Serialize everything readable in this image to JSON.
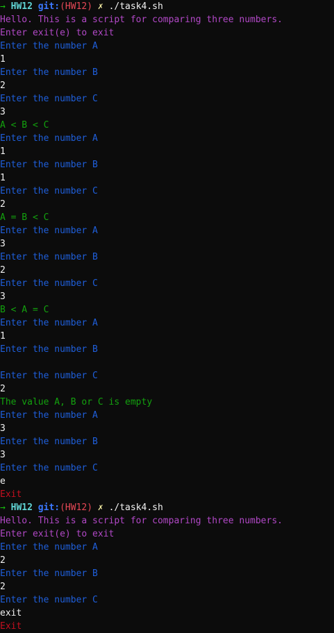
{
  "window": {
    "title": ""
  },
  "colors": {
    "background": "#0c0c0c",
    "purple": "#b148c6",
    "red": "#c50f1f",
    "blue": "#1f5fdb",
    "white": "#f2f2f2",
    "green": "#13a10e",
    "cyan": "#61d6d6",
    "yellow": "#f9f1a5"
  },
  "prompt": {
    "arrow": "→",
    "dir": "HW12",
    "git_label": "git:",
    "branch": "(HW12)",
    "dirty_mark": "✗",
    "command": "./task4.sh"
  },
  "lines": [
    {
      "kind": "prompt"
    },
    {
      "text": "Hello. This is a script for comparing three numbers.",
      "color": "purple"
    },
    {
      "text": "Enter exit(e) to exit",
      "color": "purple"
    },
    {
      "text": "Enter the number A",
      "color": "blue"
    },
    {
      "text": "1",
      "color": "white"
    },
    {
      "text": "Enter the number B",
      "color": "blue"
    },
    {
      "text": "2",
      "color": "white"
    },
    {
      "text": "Enter the number C",
      "color": "blue"
    },
    {
      "text": "3",
      "color": "white"
    },
    {
      "text": "A < B < C",
      "color": "green"
    },
    {
      "text": "Enter the number A",
      "color": "blue"
    },
    {
      "text": "1",
      "color": "white"
    },
    {
      "text": "Enter the number B",
      "color": "blue"
    },
    {
      "text": "1",
      "color": "white"
    },
    {
      "text": "Enter the number C",
      "color": "blue"
    },
    {
      "text": "2",
      "color": "white"
    },
    {
      "text": "A = B < C",
      "color": "green"
    },
    {
      "text": "Enter the number A",
      "color": "blue"
    },
    {
      "text": "3",
      "color": "white"
    },
    {
      "text": "Enter the number B",
      "color": "blue"
    },
    {
      "text": "2",
      "color": "white"
    },
    {
      "text": "Enter the number C",
      "color": "blue"
    },
    {
      "text": "3",
      "color": "white"
    },
    {
      "text": "B < A = C",
      "color": "green"
    },
    {
      "text": "Enter the number A",
      "color": "blue"
    },
    {
      "text": "1",
      "color": "white"
    },
    {
      "text": "Enter the number B",
      "color": "blue"
    },
    {
      "text": "",
      "color": "white"
    },
    {
      "text": "Enter the number C",
      "color": "blue"
    },
    {
      "text": "2",
      "color": "white"
    },
    {
      "text": "The value A, B or C is empty",
      "color": "green"
    },
    {
      "text": "Enter the number A",
      "color": "blue"
    },
    {
      "text": "3",
      "color": "white"
    },
    {
      "text": "Enter the number B",
      "color": "blue"
    },
    {
      "text": "3",
      "color": "white"
    },
    {
      "text": "Enter the number C",
      "color": "blue"
    },
    {
      "text": "e",
      "color": "white"
    },
    {
      "text": "Exit",
      "color": "red"
    },
    {
      "kind": "prompt"
    },
    {
      "text": "Hello. This is a script for comparing three numbers.",
      "color": "purple"
    },
    {
      "text": "Enter exit(e) to exit",
      "color": "purple"
    },
    {
      "text": "Enter the number A",
      "color": "blue"
    },
    {
      "text": "2",
      "color": "white"
    },
    {
      "text": "Enter the number B",
      "color": "blue"
    },
    {
      "text": "2",
      "color": "white"
    },
    {
      "text": "Enter the number C",
      "color": "blue"
    },
    {
      "text": "exit",
      "color": "white"
    },
    {
      "text": "Exit",
      "color": "red"
    }
  ]
}
